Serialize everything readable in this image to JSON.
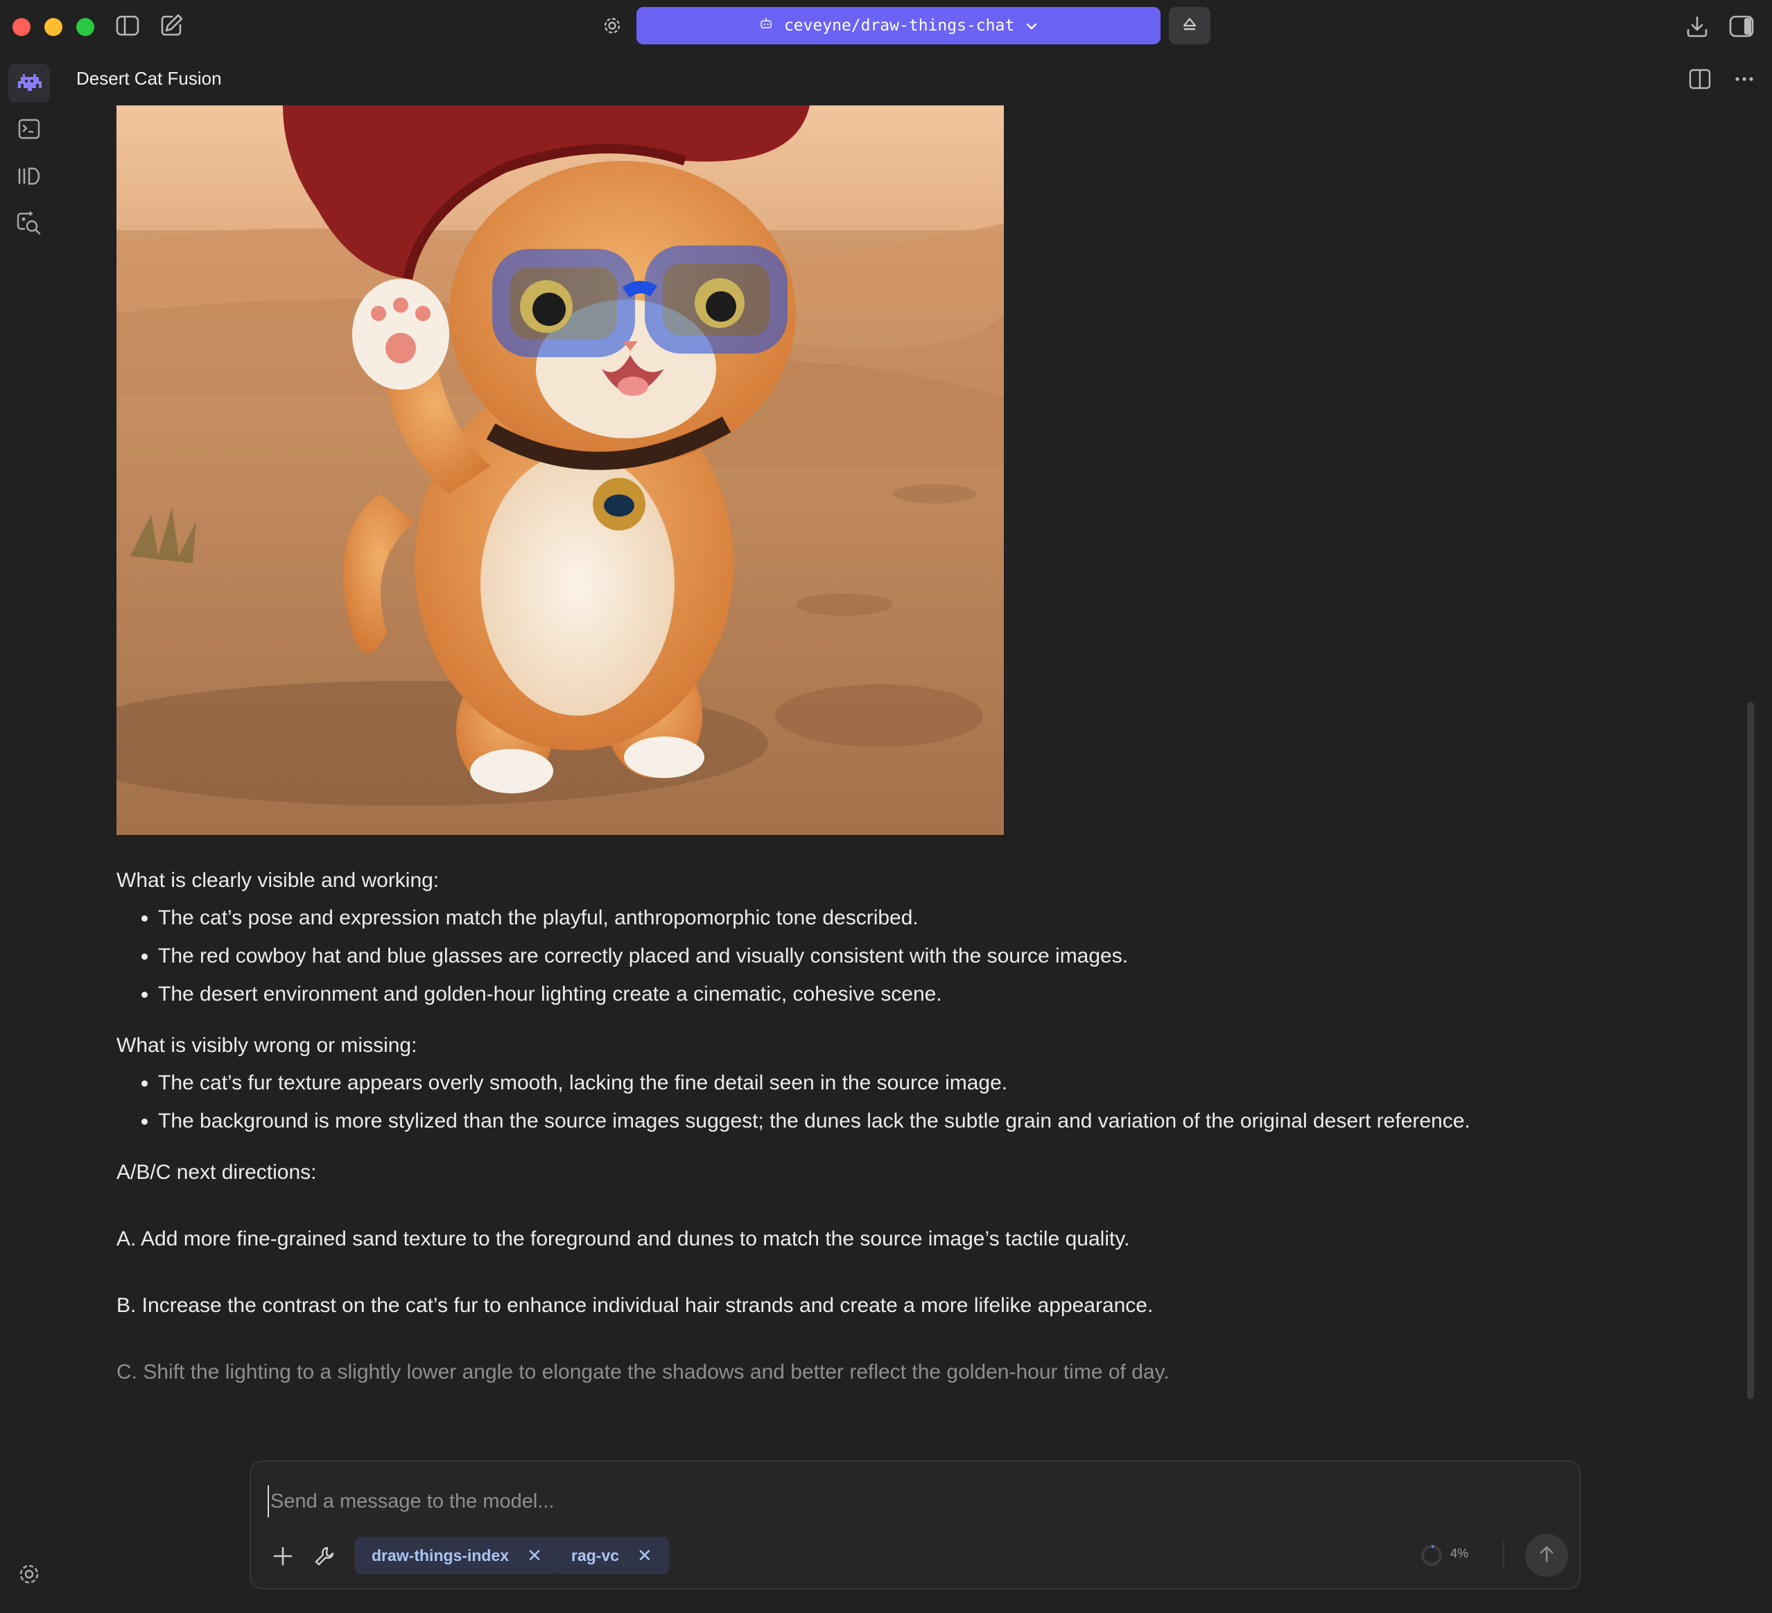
{
  "window": {
    "model_pill": {
      "label": "ceveyne/draw-things-chat"
    },
    "chat_title": "Desert Cat Fusion"
  },
  "message": {
    "heading_visible": "What is clearly visible and working:",
    "visible_items": [
      "The cat’s pose and expression match the playful, anthropomorphic tone described.",
      "The red cowboy hat and blue glasses are correctly placed and visually consistent with the source images.",
      "The desert environment and golden-hour lighting create a cinematic, cohesive scene."
    ],
    "heading_wrong": "What is visibly wrong or missing:",
    "wrong_items": [
      "The cat’s fur texture appears overly smooth, lacking the fine detail seen in the source image.",
      "The background is more stylized than the source images suggest; the dunes lack the subtle grain and variation of the original desert reference."
    ],
    "heading_next": "A/B/C next directions:",
    "direction_a": "A. Add more fine-grained sand texture to the foreground and dunes to match the source image’s tactile quality.",
    "direction_b": "B. Increase the contrast on the cat’s fur to enhance individual hair strands and create a more lifelike appearance.",
    "direction_c": "C. Shift the lighting to a slightly lower angle to elongate the shadows and better reflect the golden-hour time of day."
  },
  "composer": {
    "placeholder": "Send a message to the model...",
    "tools": [
      "draw-things-index",
      "rag-vc"
    ],
    "context_usage": "4%"
  },
  "colors": {
    "accent": "#6a63f3",
    "background": "#212122",
    "chip_bg": "#2f3448",
    "chip_text": "#a9c4f2"
  },
  "icons": [
    "sidebar-toggle-icon",
    "compose-icon",
    "settings-icon",
    "model-icon",
    "chevron-down-icon",
    "eject-icon",
    "download-icon",
    "right-panel-icon",
    "app-logo-icon",
    "terminal-icon",
    "library-icon",
    "search-images-icon",
    "split-view-icon",
    "more-icon",
    "plus-icon",
    "tools-icon",
    "close-icon",
    "send-icon"
  ]
}
